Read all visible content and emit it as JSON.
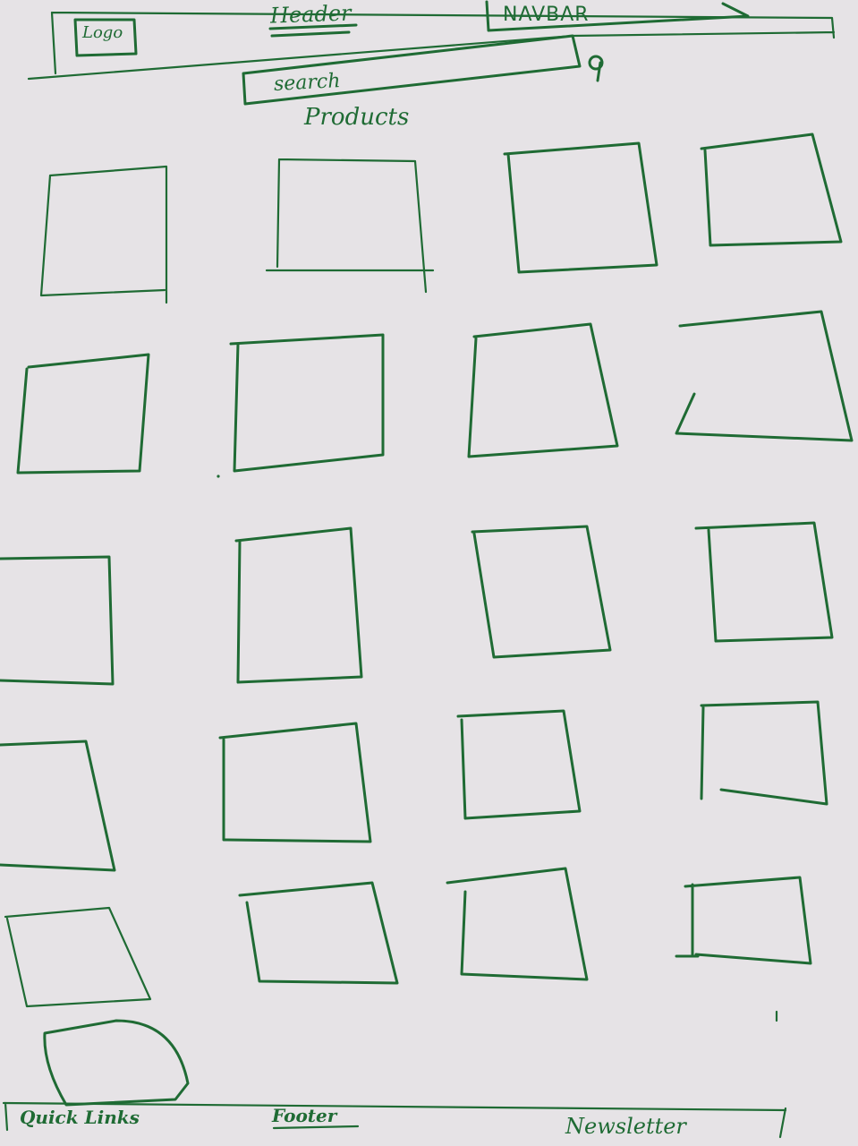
{
  "header": {
    "logo_label": "Logo",
    "title": "Header",
    "navbar_label": "NAVBAR"
  },
  "search": {
    "placeholder": "search",
    "icon": "magnifier-icon"
  },
  "products": {
    "heading": "Products",
    "card_count": 21
  },
  "footer": {
    "quick_links": "Quick Links",
    "title": "Footer",
    "newsletter": "Newsletter"
  },
  "colors": {
    "ink": "#1f6b34",
    "paper": "#e6e3e6",
    "table": "#c9ae86"
  }
}
